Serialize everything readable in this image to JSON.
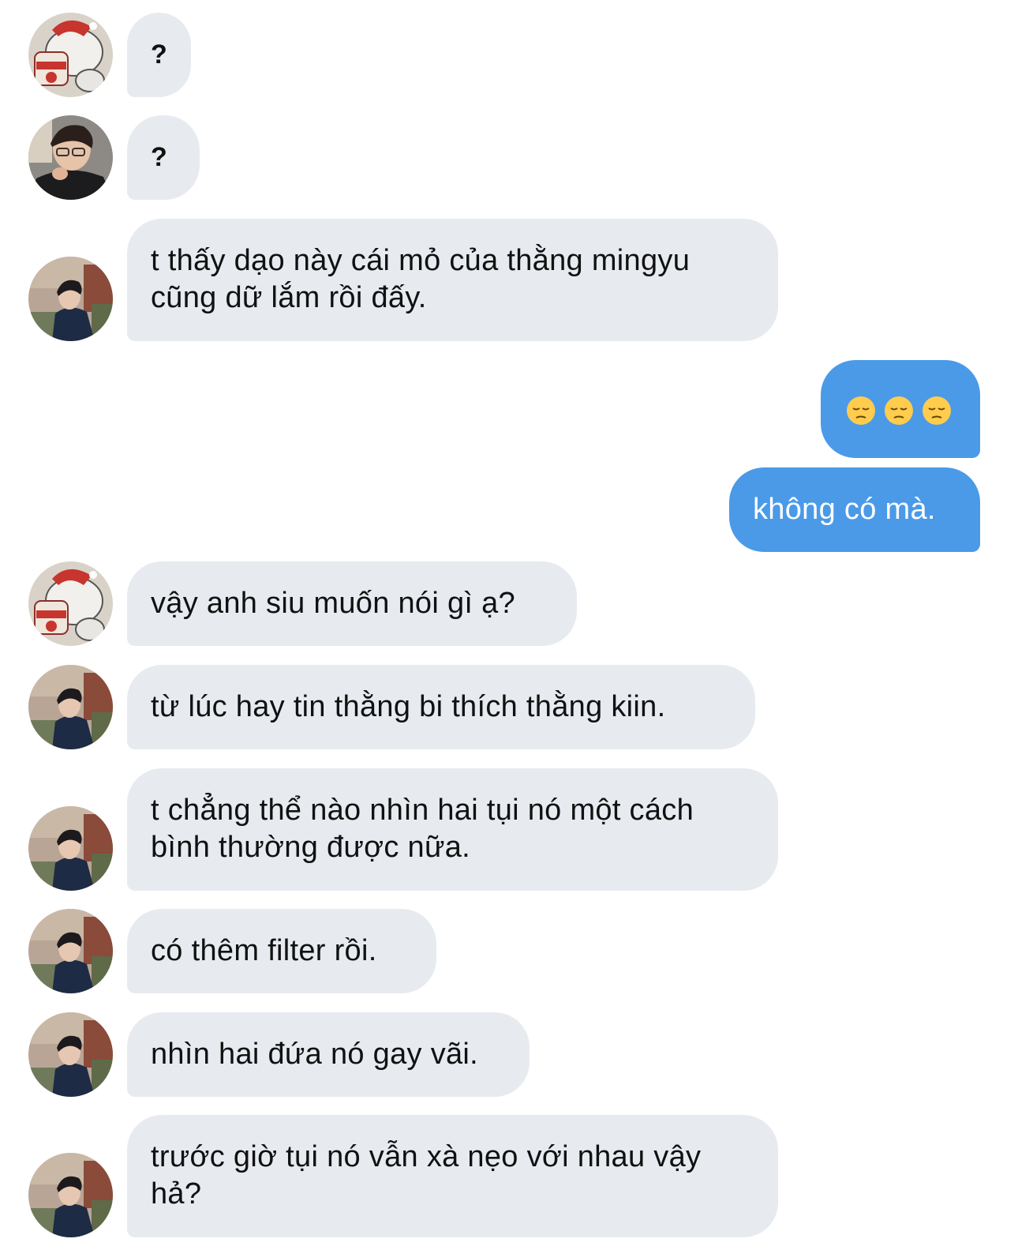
{
  "messages": [
    {
      "sender": "bear",
      "text": "?"
    },
    {
      "sender": "glasses",
      "text": "?"
    },
    {
      "sender": "street",
      "text": "t thấy dạo này cái mỏ của thằng mingyu cũng dữ lắm rồi đấy."
    },
    {
      "sender": "me",
      "text": "",
      "emoji": [
        "pensive-face",
        "pensive-face",
        "pensive-face"
      ]
    },
    {
      "sender": "me",
      "text": "không có mà."
    },
    {
      "sender": "bear",
      "text": "vậy anh siu muốn nói gì ạ?"
    },
    {
      "sender": "street",
      "text": "từ lúc hay tin thằng bi thích thằng kiin."
    },
    {
      "sender": "street",
      "text": "t chẳng thể nào nhìn hai tụi nó một cách bình thường được nữa."
    },
    {
      "sender": "street",
      "text": "có thêm filter rồi."
    },
    {
      "sender": "street",
      "text": "nhìn hai đứa nó gay vãi."
    },
    {
      "sender": "street",
      "text": "trước giờ tụi nó vẫn xà nẹo với nhau vậy hả?"
    }
  ],
  "colors": {
    "incoming_bubble": "#e7ebf0",
    "outgoing_bubble": "#4a9ae8",
    "incoming_text": "#111111",
    "outgoing_text": "#ffffff"
  }
}
